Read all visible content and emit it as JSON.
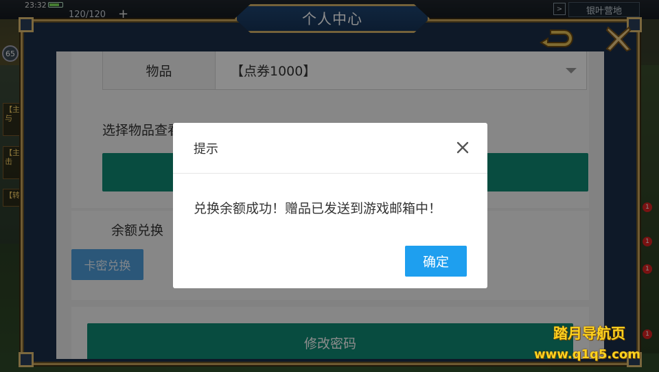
{
  "hud": {
    "time": "23:32",
    "stamina": "120/120",
    "plus": "+",
    "level": "65",
    "camp_label": "银叶营地",
    "play_icon": ">",
    "left_tags": [
      "【主】与",
      "【主】击",
      "【转】"
    ],
    "notif_counts": [
      "1",
      "1",
      "1",
      "1"
    ]
  },
  "window": {
    "title": "个人中心",
    "back_icon": "back-arrow-icon",
    "close_icon": "close-x-icon"
  },
  "form": {
    "item_label": "物品",
    "item_value": "【点券1000】",
    "hint_visible": "选择物品查看",
    "balance_label": "余额兑换",
    "card_exchange_label": "卡密兑换",
    "change_password_label": "修改密码"
  },
  "modal": {
    "title": "提示",
    "message": "兑换余额成功！赠品已发送到游戏邮箱中！",
    "ok_label": "确定"
  },
  "watermark": {
    "title": "踏月导航页",
    "url": "www.q1q5.com"
  },
  "colors": {
    "teal": "#108a76",
    "blue_button": "#1e9fef",
    "card_button": "#4f9fdc",
    "frame_gold": "#c9a45c",
    "frame_blue": "#1a2e4a"
  }
}
